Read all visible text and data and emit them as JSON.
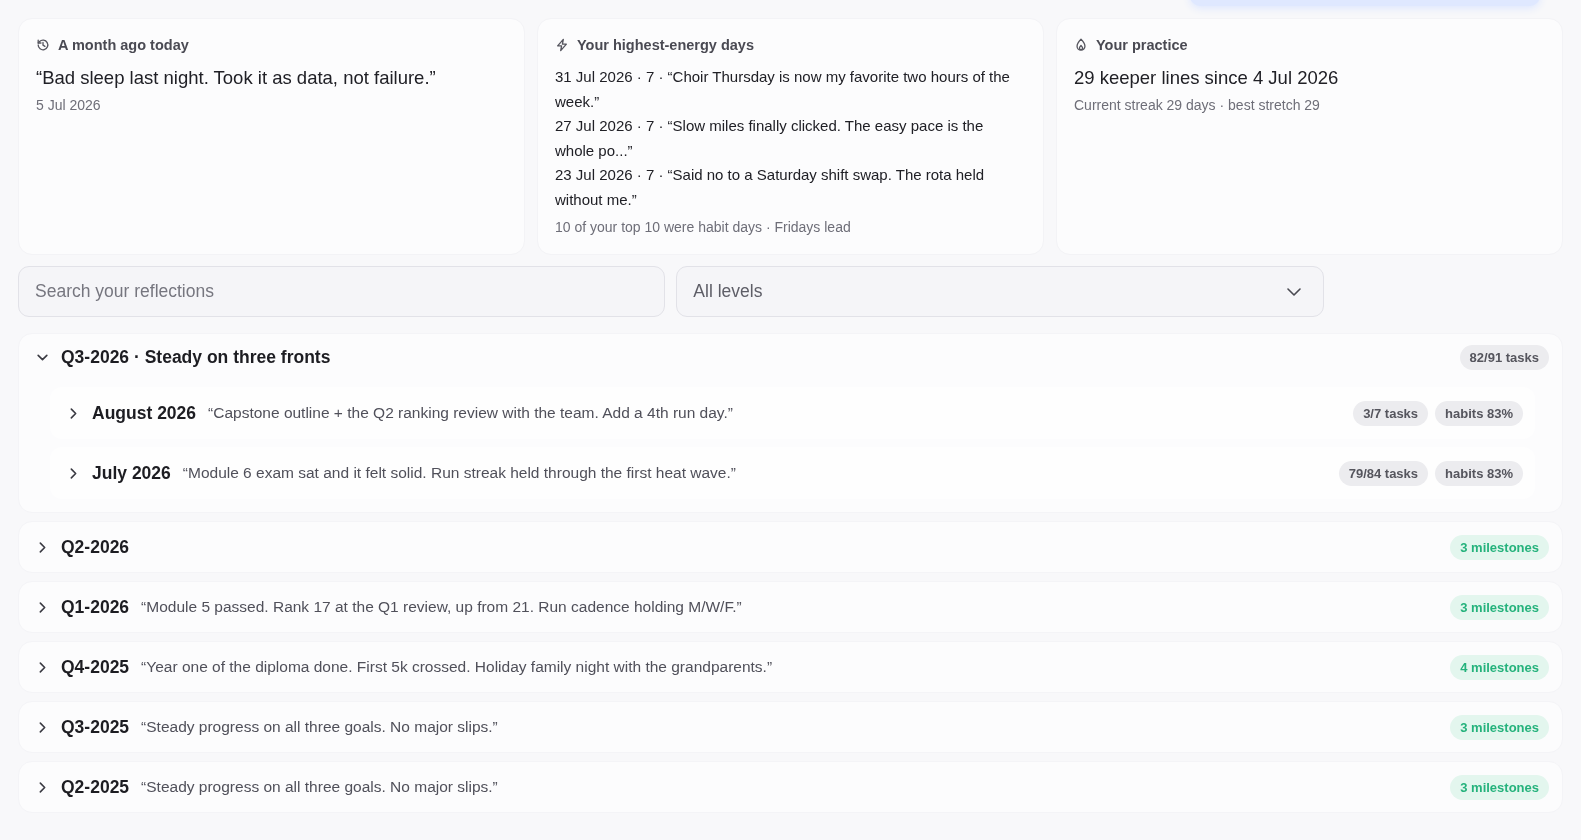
{
  "cards": [
    {
      "kind": "memory",
      "title": "A month ago today",
      "lines": [
        "“Bad sleep last night. Took it as data, not failure.”"
      ],
      "note": "5 Jul 2026"
    },
    {
      "kind": "energy",
      "title": "Your highest-energy days",
      "lines": [
        "31 Jul 2026 · 7 · “Choir Thursday is now my favorite two hours of the week.”",
        "27 Jul 2026 · 7 · “Slow miles finally clicked. The easy pace is the whole po...”",
        "23 Jul 2026 · 7 · “Said no to a Saturday shift swap. The rota held without me.”"
      ],
      "note": "10 of your top 10 were habit days · Fridays lead"
    },
    {
      "kind": "practice",
      "title": "Your practice",
      "lines": [
        "29 keeper lines since 4 Jul 2026"
      ],
      "note": "Current streak 29 days · best stretch 29"
    }
  ],
  "filters": {
    "search": {
      "placeholder": "Search your reflections"
    },
    "level_select": {
      "value": "All levels"
    }
  },
  "quarters": [
    {
      "title": "Q3-2026 · Steady on three fronts",
      "expanded": true,
      "badges": [
        {
          "text": "82/91 tasks",
          "kind": "neutral"
        }
      ],
      "children": [
        {
          "title": "August 2026",
          "quote": "“Capstone outline + the Q2 ranking review with the team. Add a 4th run day.”",
          "expanded": false,
          "badges": [
            {
              "text": "3/7 tasks",
              "kind": "neutral"
            },
            {
              "text": "habits 83%",
              "kind": "neutral"
            }
          ]
        },
        {
          "title": "July 2026",
          "quote": "“Module 6 exam sat and it felt solid. Run streak held through the first heat wave.”",
          "expanded": false,
          "badges": [
            {
              "text": "79/84 tasks",
              "kind": "neutral"
            },
            {
              "text": "habits 83%",
              "kind": "neutral"
            }
          ]
        }
      ]
    },
    {
      "title": "Q2-2026",
      "expanded": false,
      "badges": [
        {
          "text": "3 milestones",
          "kind": "milestone"
        }
      ]
    },
    {
      "title": "Q1-2026",
      "quote": "“Module 5 passed. Rank 17 at the Q1 review, up from 21. Run cadence holding M/W/F.”",
      "expanded": false,
      "badges": [
        {
          "text": "3 milestones",
          "kind": "milestone"
        }
      ]
    },
    {
      "title": "Q4-2025",
      "quote": "“Year one of the diploma done. First 5k crossed. Holiday family night with the grandparents.”",
      "expanded": false,
      "badges": [
        {
          "text": "4 milestones",
          "kind": "milestone"
        }
      ]
    },
    {
      "title": "Q3-2025",
      "quote": "“Steady progress on all three goals. No major slips.”",
      "expanded": false,
      "badges": [
        {
          "text": "3 milestones",
          "kind": "milestone"
        }
      ]
    },
    {
      "title": "Q2-2025",
      "quote": "“Steady progress on all three goals. No major slips.”",
      "expanded": false,
      "badges": [
        {
          "text": "3 milestones",
          "kind": "milestone"
        }
      ]
    }
  ]
}
